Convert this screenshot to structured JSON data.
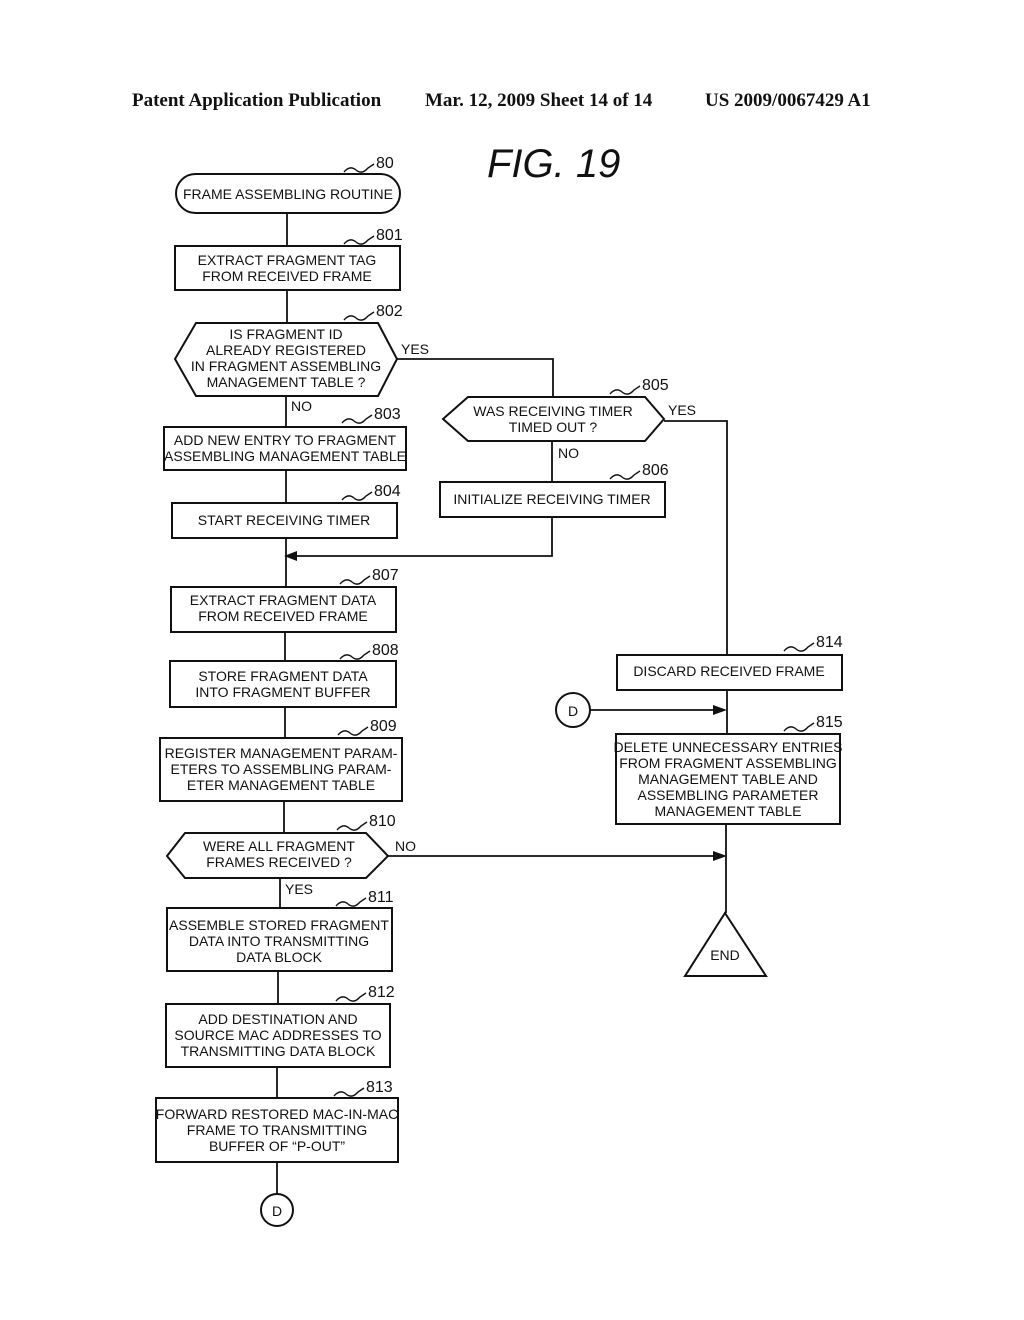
{
  "header": {
    "publication": "Patent Application Publication",
    "date_sheet": "Mar. 12, 2009  Sheet 14 of 14",
    "number": "US 2009/0067429 A1"
  },
  "figure": {
    "title": "FIG. 19"
  },
  "nodes": {
    "n80": {
      "ref": "80",
      "type": "terminal",
      "lines": [
        "FRAME ASSEMBLING ROUTINE"
      ]
    },
    "n801": {
      "ref": "801",
      "type": "process",
      "lines": [
        "EXTRACT FRAGMENT TAG",
        "FROM RECEIVED FRAME"
      ]
    },
    "n802": {
      "ref": "802",
      "type": "decision",
      "lines": [
        "IS FRAGMENT ID",
        "ALREADY REGISTERED",
        "IN FRAGMENT ASSEMBLING",
        "MANAGEMENT TABLE ?"
      ]
    },
    "n803": {
      "ref": "803",
      "type": "process",
      "lines": [
        "ADD NEW ENTRY TO FRAGMENT",
        "ASSEMBLING MANAGEMENT TABLE"
      ]
    },
    "n804": {
      "ref": "804",
      "type": "process",
      "lines": [
        "START RECEIVING TIMER"
      ]
    },
    "n805": {
      "ref": "805",
      "type": "decision",
      "lines": [
        "WAS RECEIVING TIMER",
        "TIMED OUT ?"
      ]
    },
    "n806": {
      "ref": "806",
      "type": "process",
      "lines": [
        "INITIALIZE RECEIVING TIMER"
      ]
    },
    "n807": {
      "ref": "807",
      "type": "process",
      "lines": [
        "EXTRACT FRAGMENT DATA",
        "FROM RECEIVED FRAME"
      ]
    },
    "n808": {
      "ref": "808",
      "type": "process",
      "lines": [
        "STORE FRAGMENT DATA",
        "INTO FRAGMENT BUFFER"
      ]
    },
    "n809": {
      "ref": "809",
      "type": "process",
      "lines": [
        "REGISTER MANAGEMENT PARAM-",
        "ETERS TO ASSEMBLING PARAM-",
        "ETER MANAGEMENT TABLE"
      ]
    },
    "n810": {
      "ref": "810",
      "type": "decision",
      "lines": [
        "WERE ALL FRAGMENT",
        "FRAMES RECEIVED ?"
      ]
    },
    "n811": {
      "ref": "811",
      "type": "process",
      "lines": [
        "ASSEMBLE STORED FRAGMENT",
        "DATA INTO TRANSMITTING",
        "DATA BLOCK"
      ]
    },
    "n812": {
      "ref": "812",
      "type": "process",
      "lines": [
        "ADD DESTINATION AND",
        "SOURCE MAC ADDRESSES TO",
        "TRANSMITTING DATA BLOCK"
      ]
    },
    "n813": {
      "ref": "813",
      "type": "process",
      "lines": [
        "FORWARD RESTORED MAC-IN-MAC",
        "FRAME TO TRANSMITTING",
        "BUFFER OF “P-OUT”"
      ]
    },
    "n814": {
      "ref": "814",
      "type": "process",
      "lines": [
        "DISCARD RECEIVED FRAME"
      ]
    },
    "n815": {
      "ref": "815",
      "type": "process",
      "lines": [
        "DELETE UNNECESSARY ENTRIES",
        "FROM FRAGMENT ASSEMBLING",
        "MANAGEMENT TABLE AND",
        "ASSEMBLING PARAMETER",
        "MANAGEMENT TABLE"
      ]
    },
    "connD_out": {
      "type": "connector",
      "lines": [
        "D"
      ]
    },
    "connD_in": {
      "type": "connector",
      "lines": [
        "D"
      ]
    },
    "end": {
      "type": "end",
      "lines": [
        "END"
      ]
    }
  },
  "edge_labels": {
    "e802_yes": "YES",
    "e802_no": "NO",
    "e805_yes": "YES",
    "e805_no": "NO",
    "e810_no": "NO",
    "e810_yes": "YES"
  },
  "edges": [
    {
      "from": "n80",
      "to": "n801"
    },
    {
      "from": "n801",
      "to": "n802"
    },
    {
      "from": "n802",
      "to": "n805",
      "label": "YES"
    },
    {
      "from": "n802",
      "to": "n803",
      "label": "NO"
    },
    {
      "from": "n803",
      "to": "n804"
    },
    {
      "from": "n804",
      "to": "n807"
    },
    {
      "from": "n805",
      "to": "n814",
      "label": "YES"
    },
    {
      "from": "n805",
      "to": "n806",
      "label": "NO"
    },
    {
      "from": "n806",
      "to": "n807"
    },
    {
      "from": "n807",
      "to": "n808"
    },
    {
      "from": "n808",
      "to": "n809"
    },
    {
      "from": "n809",
      "to": "n810"
    },
    {
      "from": "n810",
      "to": "end",
      "label": "NO"
    },
    {
      "from": "n810",
      "to": "n811",
      "label": "YES"
    },
    {
      "from": "n811",
      "to": "n812"
    },
    {
      "from": "n812",
      "to": "n813"
    },
    {
      "from": "n813",
      "to": "connD_out"
    },
    {
      "from": "connD_in",
      "to": "n815"
    },
    {
      "from": "n814",
      "to": "n815"
    },
    {
      "from": "n815",
      "to": "end"
    }
  ]
}
